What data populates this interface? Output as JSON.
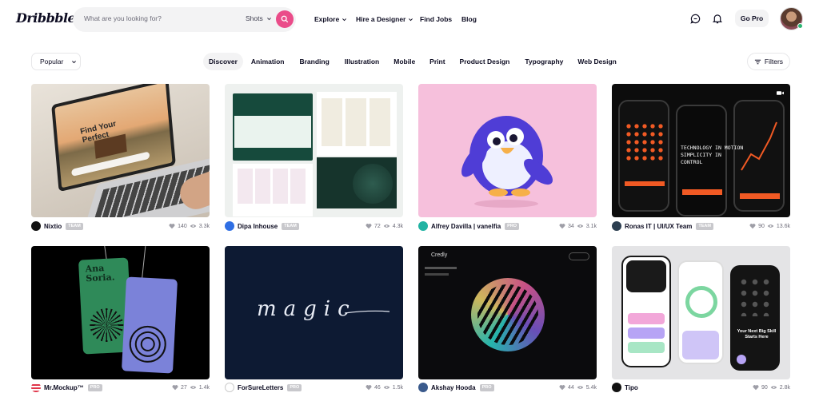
{
  "header": {
    "logo": "Dribbble",
    "search_placeholder": "What are you looking for?",
    "search_scope": "Shots",
    "nav": [
      "Explore",
      "Hire a Designer",
      "Find Jobs",
      "Blog"
    ],
    "go_pro": "Go Pro"
  },
  "filters": {
    "sort": "Popular",
    "categories": [
      "Discover",
      "Animation",
      "Branding",
      "Illustration",
      "Mobile",
      "Print",
      "Product Design",
      "Typography",
      "Web Design"
    ],
    "active_category": "Discover",
    "filters_label": "Filters"
  },
  "shots": [
    {
      "author": "Nixtio",
      "badge": "TEAM",
      "likes": "140",
      "views": "3.3k",
      "overlay": "Find Your Perfect"
    },
    {
      "author": "Dipa Inhouse",
      "badge": "TEAM",
      "likes": "72",
      "views": "4.3k"
    },
    {
      "author": "Alfrey Davilla | vanelfia",
      "badge": "PRO",
      "likes": "34",
      "views": "3.1k"
    },
    {
      "author": "Ronas IT | UI/UX Team",
      "badge": "TEAM",
      "likes": "90",
      "views": "13.6k",
      "overlay": "TECHNOLOGY IN MOTION SIMPLICITY IN CONTROL"
    },
    {
      "author": "Mr.Mockup™",
      "badge": "PRO",
      "likes": "27",
      "views": "1.4k",
      "overlay": "Ana Soria."
    },
    {
      "author": "ForSureLetters",
      "badge": "PRO",
      "likes": "46",
      "views": "1.5k",
      "overlay": "magic"
    },
    {
      "author": "Akshay Hooda",
      "badge": "PRO",
      "likes": "44",
      "views": "5.4k",
      "overlay": "Credly"
    },
    {
      "author": "Tipo",
      "badge": "",
      "likes": "90",
      "views": "2.8k",
      "overlay": "Your Next Big Skill Starts Here"
    }
  ],
  "colors": {
    "brand": "#ea4c89",
    "text": "#0d0c22",
    "muted": "#6e6d7a",
    "chip": "#f3f3f4"
  }
}
